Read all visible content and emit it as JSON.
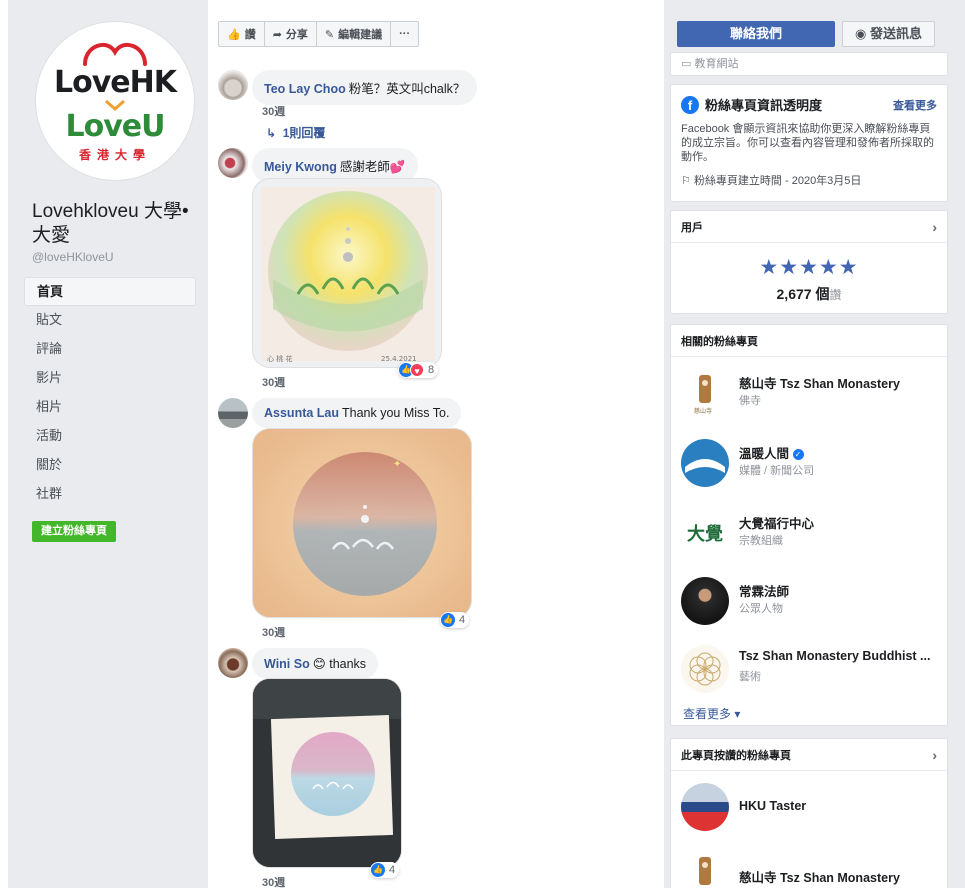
{
  "colors": {
    "brand_blue": "#4267b2",
    "link": "#385898",
    "green": "#42b72a",
    "bg": "#e9ebee"
  },
  "page": {
    "logo_line1": "LoveHK",
    "logo_line2": "LoveU",
    "logo_sub": "香港大學",
    "name": "Lovehkloveu 大學•大愛",
    "handle": "@loveHKloveU"
  },
  "nav": {
    "items": [
      {
        "label": "首頁",
        "active": true
      },
      {
        "label": "貼文"
      },
      {
        "label": "評論"
      },
      {
        "label": "影片"
      },
      {
        "label": "相片"
      },
      {
        "label": "活動"
      },
      {
        "label": "關於"
      },
      {
        "label": "社群"
      }
    ],
    "create_label": "建立粉絲專頁"
  },
  "toolbar": {
    "like_label": "讚",
    "share_label": "分享",
    "edit_label": "編輯建議",
    "more_label": "···"
  },
  "comments": [
    {
      "author": "Teo Lay Choo",
      "text": "粉笔？英文叫chalk？",
      "time": "30週",
      "reply": "1則回覆"
    },
    {
      "author": "Meiy Kwong",
      "text": "感謝老師💕",
      "time": "30週",
      "reactions": "8",
      "pic_signature": "心 桃 花",
      "pic_date": "25.4.2021"
    },
    {
      "author": "Assunta Lau",
      "text": "Thank you Miss To.",
      "time": "30週",
      "reactions": "4"
    },
    {
      "author": "Wini So",
      "text": "😊 thanks",
      "time": "30週",
      "reactions": "4"
    }
  ],
  "right": {
    "contact_label": "聯絡我們",
    "message_label": "發送訊息",
    "partial_label": "教育網站",
    "transparency": {
      "title": "粉絲專頁資訊透明度",
      "see_more": "查看更多",
      "desc": "Facebook 會顯示資訊來協助你更深入瞭解粉絲專頁的成立宗旨。你可以查看內容管理和發佈者所採取的動作。",
      "created": "粉絲專頁建立時間 - 2020年3月5日"
    },
    "users": {
      "title": "用戶",
      "stars": "★★★★★",
      "rating": 5,
      "count": "2,677 個",
      "count_unit": "讚"
    },
    "related": {
      "title": "相關的粉絲專頁",
      "items": [
        {
          "name": "慈山寺 Tsz Shan Monastery",
          "category": "佛寺"
        },
        {
          "name": "溫暖人間",
          "category": "媒體 / 新聞公司",
          "verified": true
        },
        {
          "name": "大覺福行中心",
          "category": "宗教組織",
          "logo_text": "大覺"
        },
        {
          "name": "常霖法師",
          "category": "公眾人物"
        },
        {
          "name": "Tsz Shan Monastery Buddhist ...",
          "category": "藝術"
        }
      ],
      "see_more": "查看更多"
    },
    "liked": {
      "title": "此專頁按讚的粉絲專頁",
      "items": [
        {
          "name": "HKU Taster"
        },
        {
          "name": "慈山寺 Tsz Shan Monastery"
        }
      ]
    }
  }
}
